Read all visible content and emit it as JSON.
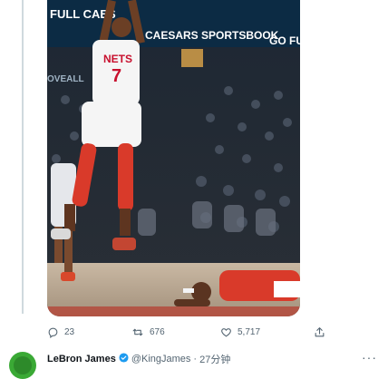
{
  "tweet": {
    "media": {
      "banner_text_left": "FULL CAES",
      "banner_text_center": "CAESARS SPORTSBOOK",
      "banner_text_right": "GO FUL",
      "side_text": "OVEALL",
      "jersey_text": "NETS",
      "jersey_number": "7"
    },
    "stats": {
      "replies": "23",
      "retweets": "676",
      "likes": "5,717"
    }
  },
  "next_tweet": {
    "name": "LeBron James",
    "handle": "@KingJames",
    "separator": "·",
    "time": "27分钟",
    "more": "···"
  }
}
